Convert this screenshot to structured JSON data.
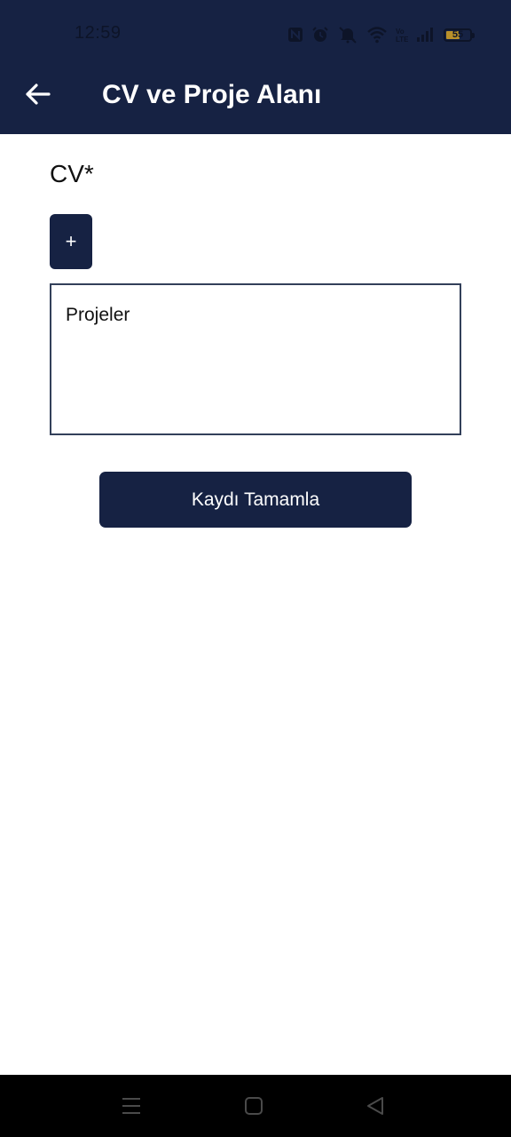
{
  "status_bar": {
    "time": "12:59",
    "battery_level": "55",
    "icons": [
      "nfc-icon",
      "alarm-icon",
      "mute-icon",
      "wifi-icon",
      "volte-icon",
      "signal-icon",
      "battery-icon"
    ]
  },
  "header": {
    "title": "CV ve Proje Alanı",
    "background_color": "#162243"
  },
  "form": {
    "cv_label": "CV*",
    "add_cv_label": "+",
    "projects_placeholder": "Projeler",
    "submit_label": "Kaydı Tamamla"
  },
  "colors": {
    "primary": "#162243",
    "background": "#ffffff"
  }
}
